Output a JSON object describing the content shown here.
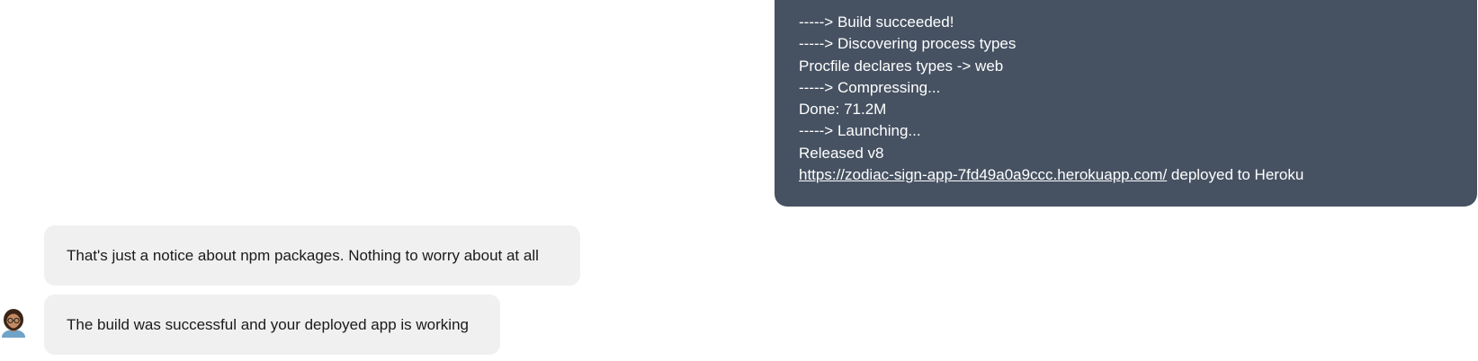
{
  "outgoing_message": {
    "lines": [
      "-----> Build succeeded!",
      "-----> Discovering process types",
      "Procfile declares types -> web",
      "-----> Compressing...",
      "Done: 71.2M",
      "-----> Launching...",
      "Released v8"
    ],
    "link_text": "https://zodiac-sign-app-7fd49a0a9ccc.herokuapp.com/",
    "link_suffix": " deployed to Heroku"
  },
  "incoming_messages": [
    {
      "text": "That's just a notice about npm packages. Nothing to worry about at all"
    },
    {
      "text": "The build was successful and your deployed app is working"
    }
  ],
  "avatar": {
    "icon": "user-avatar-icon"
  },
  "colors": {
    "outgoing_bubble": "#465262",
    "incoming_bubble": "#f0f0f0",
    "outgoing_text": "#ffffff",
    "incoming_text": "#1a1a1a"
  }
}
